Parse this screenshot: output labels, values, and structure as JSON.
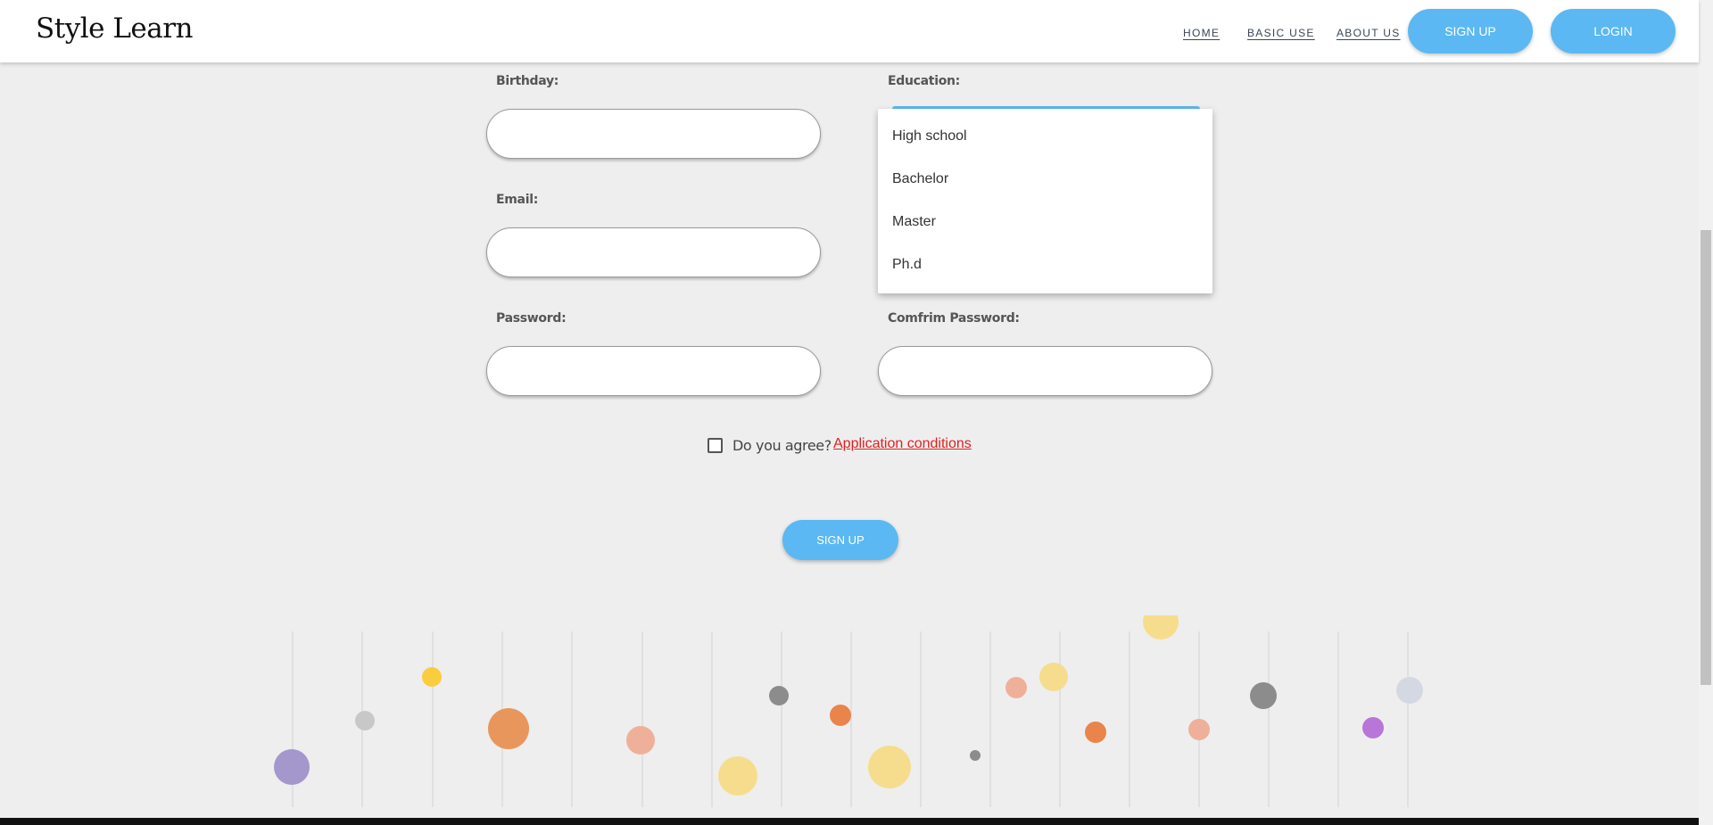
{
  "header": {
    "logo": "Style Learn",
    "nav": {
      "home": "HOME",
      "basic_use": "BASIC USE",
      "about_us": "ABOUT US"
    },
    "signup_label": "SIGN UP",
    "login_label": "LOGIN",
    "accent_color": "#5bb8f2"
  },
  "form": {
    "birthday_label": "Birthday:",
    "education_label": "Education:",
    "email_label": "Email:",
    "password_label": "Password:",
    "confirm_password_label": "Comfrim Password:",
    "education_options": [
      "High school",
      "Bachelor",
      "Master",
      "Ph.d"
    ],
    "agree_label": "Do you agree?",
    "conditions_link": "Application conditions",
    "signup_label": "SIGN UP"
  },
  "decoration": {
    "bubbles": [
      {
        "color": "#a497cc"
      },
      {
        "color": "#c8c8c8"
      },
      {
        "color": "#f9cd3e"
      },
      {
        "color": "#e9965c"
      },
      {
        "color": "#efb09a"
      },
      {
        "color": "#f6dd8d"
      },
      {
        "color": "#8c8c8c"
      },
      {
        "color": "#e9844a"
      },
      {
        "color": "#f6dd8d"
      },
      {
        "color": "#8c8c8c"
      },
      {
        "color": "#efb09a"
      },
      {
        "color": "#f6dd8d"
      },
      {
        "color": "#e9844a"
      },
      {
        "color": "#f6dd8d"
      },
      {
        "color": "#efb09a"
      },
      {
        "color": "#8c8c8c"
      },
      {
        "color": "#b776d8"
      },
      {
        "color": "#d4d8e2"
      }
    ]
  }
}
